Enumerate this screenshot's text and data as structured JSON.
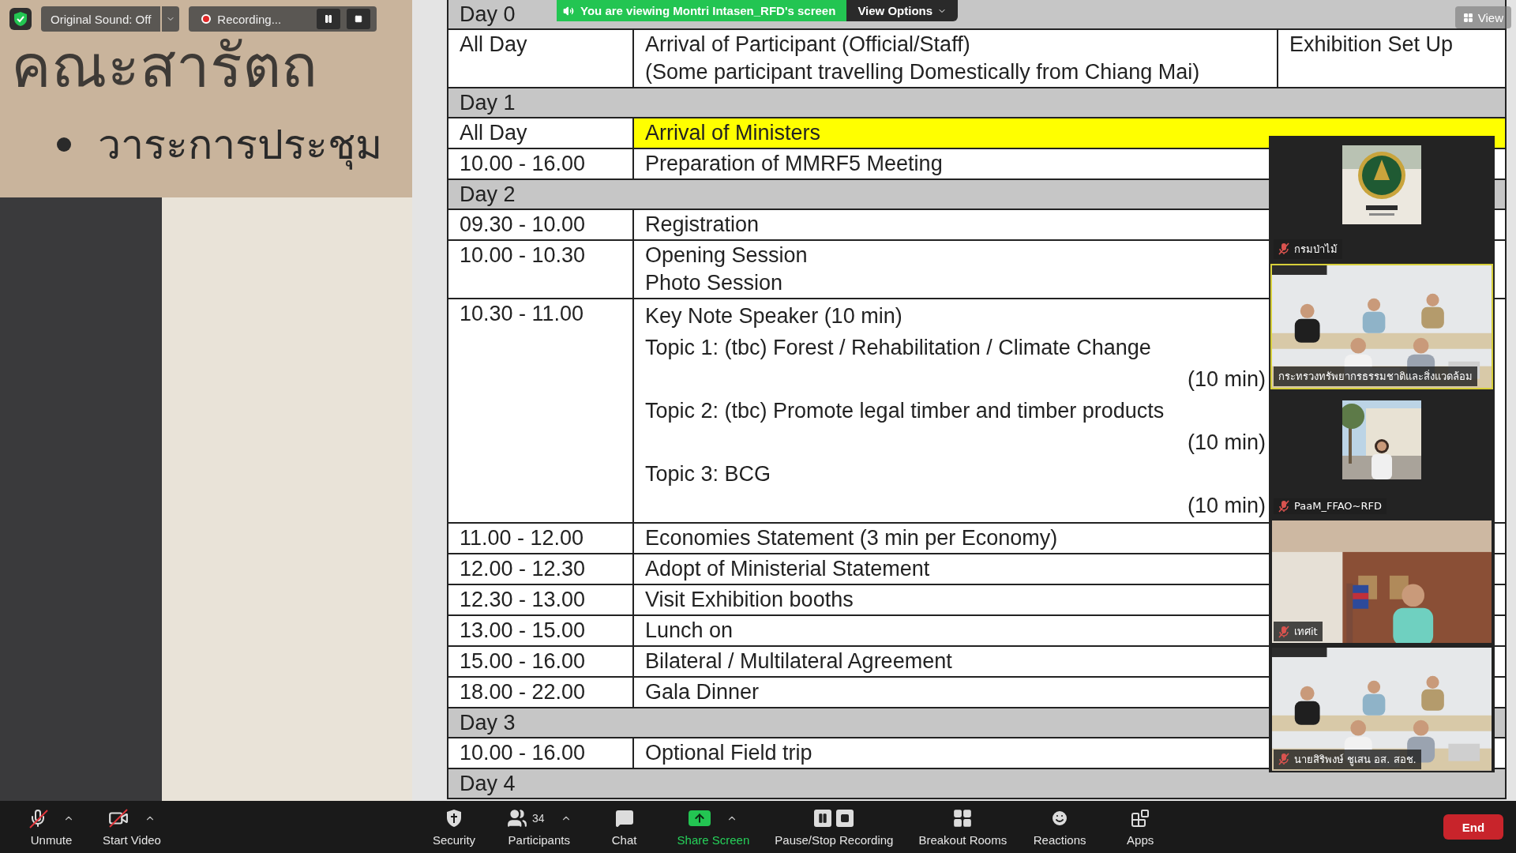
{
  "top_bar": {
    "original_sound": "Original Sound: Off",
    "recording": "Recording...",
    "viewing_banner": "You are viewing Montri Intasen_RFD's screen",
    "view_options": "View Options",
    "view": "View"
  },
  "slide": {
    "title": "คณะสารัตถ",
    "bullet": "วาระการประชุม"
  },
  "schedule": {
    "rows": [
      {
        "kind": "day",
        "label": "Day 0"
      },
      {
        "kind": "entry",
        "time": "All Day",
        "highlight": false,
        "items": [
          {
            "text": "Arrival of Participant (Official/Staff)"
          },
          {
            "text": "(Some participant travelling Domestically from Chiang Mai)"
          }
        ],
        "note": "Exhibition Set Up"
      },
      {
        "kind": "day",
        "label": "Day 1"
      },
      {
        "kind": "entry",
        "time": "All Day",
        "highlight": true,
        "items": [
          {
            "text": "Arrival of Ministers"
          }
        ]
      },
      {
        "kind": "entry",
        "time": "10.00 - 16.00",
        "highlight": false,
        "items": [
          {
            "text": "Preparation of MMRF5 Meeting"
          }
        ]
      },
      {
        "kind": "day",
        "label": "Day 2"
      },
      {
        "kind": "entry",
        "time": "09.30 - 10.00",
        "highlight": false,
        "items": [
          {
            "text": "Registration"
          }
        ]
      },
      {
        "kind": "entry",
        "time": "10.00 - 10.30",
        "highlight": false,
        "items": [
          {
            "text": "Opening Session"
          },
          {
            "text": "Photo Session"
          }
        ]
      },
      {
        "kind": "entry",
        "time": "10.30 - 11.00",
        "highlight": false,
        "items": [
          {
            "text": "Key Note Speaker (10 min)"
          },
          {
            "text": "Topic 1: (tbc) Forest / Rehabilitation / Climate Change",
            "duration": "(10 min)"
          },
          {
            "text": "Topic 2: (tbc) Promote legal timber and timber products",
            "duration": "(10 min)"
          },
          {
            "text": "Topic 3: BCG",
            "duration": "(10 min)"
          }
        ]
      },
      {
        "kind": "entry",
        "time": "11.00 - 12.00",
        "highlight": false,
        "items": [
          {
            "text": "Economies Statement (3 min per Economy)"
          }
        ]
      },
      {
        "kind": "entry",
        "time": "12.00 - 12.30",
        "highlight": false,
        "items": [
          {
            "text": "Adopt of Ministerial Statement"
          }
        ]
      },
      {
        "kind": "entry",
        "time": "12.30 - 13.00",
        "highlight": false,
        "items": [
          {
            "text": "Visit Exhibition booths"
          }
        ]
      },
      {
        "kind": "entry",
        "time": "13.00 - 15.00",
        "highlight": false,
        "items": [
          {
            "text": "Lunch on"
          }
        ]
      },
      {
        "kind": "entry",
        "time": "15.00 - 16.00",
        "highlight": false,
        "items": [
          {
            "text": "Bilateral / Multilateral Agreement"
          }
        ]
      },
      {
        "kind": "entry",
        "time": "18.00 - 22.00",
        "highlight": false,
        "items": [
          {
            "text": "Gala Dinner"
          }
        ]
      },
      {
        "kind": "day",
        "label": "Day 3"
      },
      {
        "kind": "entry",
        "time": "10.00 - 16.00",
        "highlight": false,
        "items": [
          {
            "text": "Optional Field trip"
          }
        ]
      },
      {
        "kind": "day",
        "label": "Day 4"
      }
    ]
  },
  "participants": {
    "tiles": [
      {
        "kind": "logo",
        "name": "กรมป่าไม้",
        "muted": true,
        "speaking": false
      },
      {
        "kind": "video",
        "name": "กระทรวงทรัพยากรธรรมชาติและสิ่งแวดล้อม",
        "muted": false,
        "speaking": true
      },
      {
        "name": "PaaM_FFAO~RFD",
        "muted": true,
        "speaking": false
      },
      {
        "kind": "video",
        "name": "เทศit",
        "muted": true,
        "speaking": false
      },
      {
        "kind": "video",
        "name": "นายสิริพงษ์ ชูเสน อส. สอช.",
        "muted": true,
        "speaking": false
      }
    ]
  },
  "toolbar": {
    "items": [
      {
        "kind": "mic",
        "label": "Unmute",
        "crossed": true,
        "menu": true
      },
      {
        "kind": "video",
        "label": "Start Video",
        "crossed": true,
        "menu": true
      },
      {
        "kind": "security",
        "label": "Security",
        "menu": false
      },
      {
        "kind": "participants",
        "label": "Participants",
        "count": "34",
        "menu": true
      },
      {
        "kind": "chat",
        "label": "Chat",
        "menu": false
      },
      {
        "kind": "share",
        "label": "Share Screen",
        "menu": true
      },
      {
        "kind": "record",
        "label": "Pause/Stop Recording",
        "menu": false
      },
      {
        "kind": "breakout",
        "label": "Breakout Rooms",
        "menu": false
      },
      {
        "kind": "reactions",
        "label": "Reactions",
        "menu": false
      },
      {
        "kind": "apps",
        "label": "Apps",
        "menu": false
      }
    ],
    "end": "End"
  }
}
